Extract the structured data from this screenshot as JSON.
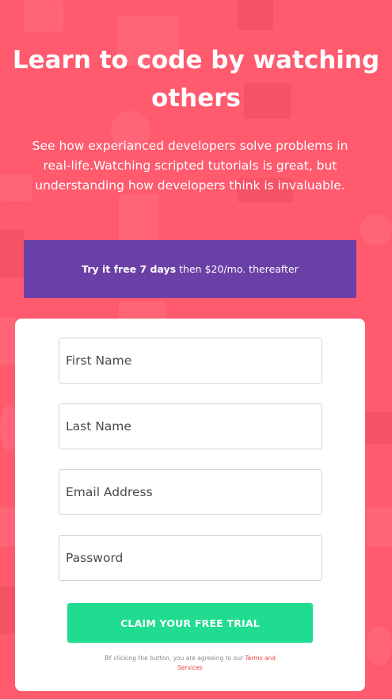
{
  "hero": {
    "title": "Learn to code by watching others",
    "subtitle": "See how experianced developers solve problems in real-life.Watching scripted tutorials is great, but understanding how developers think is invaluable."
  },
  "banner": {
    "strong_text": "Try it free 7 days",
    "rest_text": "then $20/mo. thereafter"
  },
  "form": {
    "first_name_placeholder": "First Name",
    "last_name_placeholder": "Last Name",
    "email_placeholder": "Email Address",
    "password_placeholder": "Password",
    "submit_label": "CLAIM YOUR FREE TRIAL",
    "disclaimer_text": "BY clicking the button, you are agreeing to our ",
    "terms_link": "Terms and Services"
  },
  "colors": {
    "background": "#ff5a6e",
    "banner": "#6a3fa6",
    "button": "#1fdc91",
    "link": "#e8463c"
  }
}
